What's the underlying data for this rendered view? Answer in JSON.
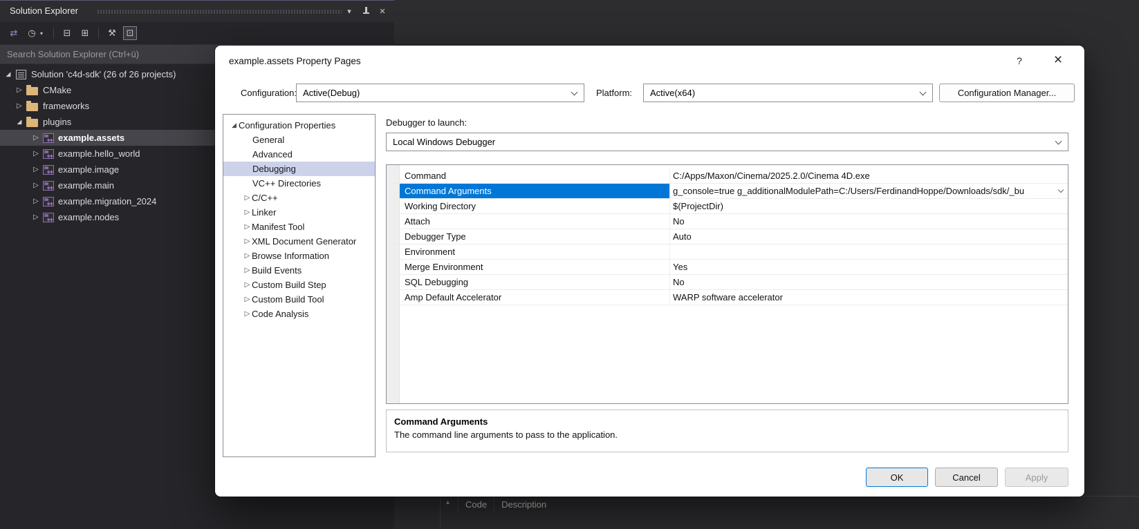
{
  "colors": {
    "accent": "#0078d7",
    "dark_background": "#2d2d30",
    "panel_background": "#26262a",
    "selection_inactive_dark": "#45454b",
    "tree_selection_light": "#ccd2e9",
    "grid_selected_row": "#0077d7",
    "folder_icon": "#dcb67a",
    "project_icon": "#8f6fb8",
    "dialog_background": "#ffffff"
  },
  "icons": {
    "titlebar": [
      "chevron-down",
      "pin",
      "close"
    ],
    "toolbar": [
      "sync-with-active-document",
      "pending-changes-filter",
      "collapse-all",
      "show-all-files",
      "properties",
      "preview-selected-items"
    ],
    "dialog": [
      "help",
      "close",
      "chevron-down"
    ]
  },
  "solution_explorer": {
    "title": "Solution Explorer",
    "search_placeholder": "Search Solution Explorer (Ctrl+ü)",
    "tree": [
      {
        "label": "Solution 'c4d-sdk' (26 of 26 projects)",
        "type": "solution",
        "state": "expanded"
      },
      {
        "label": "CMake",
        "type": "folder",
        "state": "collapsed"
      },
      {
        "label": "frameworks",
        "type": "folder",
        "state": "collapsed"
      },
      {
        "label": "plugins",
        "type": "folder",
        "state": "expanded"
      },
      {
        "label": "example.assets",
        "type": "project",
        "state": "collapsed",
        "selected": true
      },
      {
        "label": "example.hello_world",
        "type": "project",
        "state": "collapsed"
      },
      {
        "label": "example.image",
        "type": "project",
        "state": "collapsed"
      },
      {
        "label": "example.main",
        "type": "project",
        "state": "collapsed"
      },
      {
        "label": "example.migration_2024",
        "type": "project",
        "state": "collapsed"
      },
      {
        "label": "example.nodes",
        "type": "project",
        "state": "collapsed"
      }
    ]
  },
  "dialog": {
    "title": "example.assets Property Pages",
    "help_glyph": "?",
    "configuration_label": "Configuration:",
    "configuration_value": "Active(Debug)",
    "platform_label": "Platform:",
    "platform_value": "Active(x64)",
    "configuration_manager_button": "Configuration Manager...",
    "tree": [
      {
        "label": "Configuration Properties",
        "state": "expanded"
      },
      {
        "label": "General",
        "state": "leaf"
      },
      {
        "label": "Advanced",
        "state": "leaf"
      },
      {
        "label": "Debugging",
        "state": "leaf",
        "selected": true
      },
      {
        "label": "VC++ Directories",
        "state": "leaf"
      },
      {
        "label": "C/C++",
        "state": "collapsed"
      },
      {
        "label": "Linker",
        "state": "collapsed"
      },
      {
        "label": "Manifest Tool",
        "state": "collapsed"
      },
      {
        "label": "XML Document Generator",
        "state": "collapsed"
      },
      {
        "label": "Browse Information",
        "state": "collapsed"
      },
      {
        "label": "Build Events",
        "state": "collapsed"
      },
      {
        "label": "Custom Build Step",
        "state": "collapsed"
      },
      {
        "label": "Custom Build Tool",
        "state": "collapsed"
      },
      {
        "label": "Code Analysis",
        "state": "collapsed"
      }
    ],
    "debugger_to_launch_label": "Debugger to launch:",
    "debugger_value": "Local Windows Debugger",
    "properties": [
      {
        "name": "Command",
        "value": "C:/Apps/Maxon/Cinema/2025.2.0/Cinema 4D.exe"
      },
      {
        "name": "Command Arguments",
        "value": "g_console=true g_additionalModulePath=C:/Users/FerdinandHoppe/Downloads/sdk/_bu",
        "selected": true
      },
      {
        "name": "Working Directory",
        "value": "$(ProjectDir)"
      },
      {
        "name": "Attach",
        "value": "No"
      },
      {
        "name": "Debugger Type",
        "value": "Auto"
      },
      {
        "name": "Environment",
        "value": ""
      },
      {
        "name": "Merge Environment",
        "value": "Yes"
      },
      {
        "name": "SQL Debugging",
        "value": "No"
      },
      {
        "name": "Amp Default Accelerator",
        "value": "WARP software accelerator"
      }
    ],
    "description_title": "Command Arguments",
    "description_text": "The command line arguments to pass to the application.",
    "buttons": {
      "ok": "OK",
      "cancel": "Cancel",
      "apply": "Apply"
    }
  },
  "background_ui": {
    "error_list_headers": [
      "Code",
      "Description"
    ]
  }
}
